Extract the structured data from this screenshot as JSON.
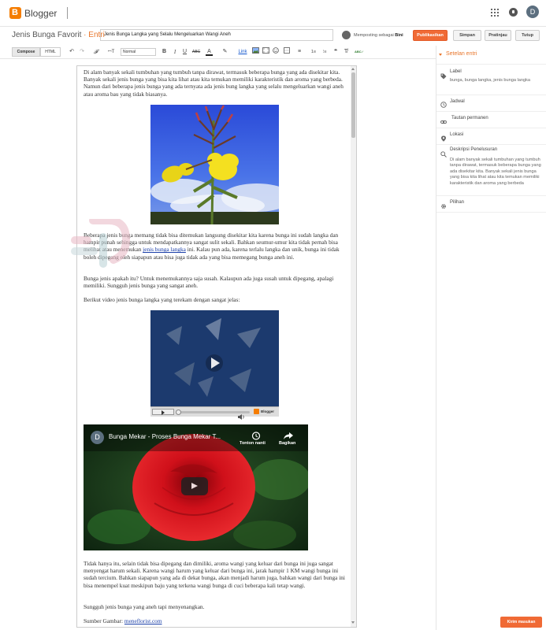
{
  "app": {
    "brand": "Blogger",
    "avatar_letter": "D"
  },
  "post": {
    "blog_title": "Jenis Bunga Favorit",
    "separator": " · ",
    "entry_label": "Entri",
    "title_value": "Jenis Bunga Langka yang Selalu Mengeluarkan Wangi Aneh",
    "posting_as_label": "Memposting sebagai",
    "posting_as_name": "Bini"
  },
  "actions": {
    "publish": "Publikasikan",
    "save": "Simpan",
    "preview": "Pratinjau",
    "close": "Tutup"
  },
  "toolbar": {
    "compose": "Compose",
    "html": "HTML",
    "undo": "↶",
    "redo": "↷",
    "font_family": "𝓕",
    "font_size": "ꟷT",
    "format": "Normal",
    "bold": "B",
    "italic": "I",
    "underline": "U",
    "strike": "ABC",
    "text_color": "A",
    "highlight": "✎",
    "link": "Link",
    "align": "≡",
    "num_list": "1≡",
    "bullet_list": "⁝≡",
    "quote": "❝",
    "clear": "T̸",
    "spell": "ABC✓"
  },
  "content": {
    "p1": "Di alam banyak sekali tumbuhan yang tumbuh tanpa dirawat, termasuk beberapa bunga yang ada disekitar kita. Banyak sekali jenis bunga yang bisa kita lihat atau kita temukan memiliki karakteristik dan aroma yang berbeda.  Namun dari beberapa jenis bunga yang ada ternyata ada jenis bung langka yang selalu mengeluarkan wangi aneh atau aroma bau yang tidak biasanya.",
    "p2_before": "Beberapa jenis bunga memang tidak bisa ditemukan langsung disekitar kita karena bunga ini sudah langka dan hampir punah sehingga untuk mendapatkannya sangat sulit sekali. Bahkan seumur-umur kita tidak pernah bisa melihat atau menemukan ",
    "p2_link": "jenis bunga langka",
    "p2_after": " ini. Kalau pun ada, karena terlalu langka dan unik, bunga ini tidak boleh dipegang oleh siapapun atau bisa juga tidak ada yang bisa memegang bunga aneh ini.",
    "p3": "Bunga jenis apakah itu? Untuk menemukannya saja susah. Kalaupun ada juga susah untuk dipegang, apalagi memiliki. Sungguh jenis bunga yang sangat aneh.",
    "p4": "Berikut video jenis bunga langka yang terekam dengan sangat jelas:",
    "video1_logo": "Blogger",
    "video2_channel": "D",
    "video2_title": "Bunga Mekar - Proses Bunga Mekar T...",
    "video2_watch_later": "Tonton nanti",
    "video2_share": "Bagikan",
    "p5": "Tidak hanya itu, selain tidak bisa dipegang dan dimiliki, aroma wangi yang keluar dari bunga ini juga sangat menyengat harum sekali. Karena wangi harum yang keluar dari bunga ini, jarak hampir 1 KM wangi bunga ini sudah tercium. Bahkan siapapun yang ada di dekat bunga, akan menjadi harum juga, bahkan wangi dari bunga ini bisa menempel kuat meskipun baju yang terkena wangi bunga di cuci beberapa kali tetap wangi.",
    "p6": "Sungguh jenis bunga yang aneh tapi menyenangkan.",
    "source_label": "Sumber Gambar: ",
    "source_link": "meneflorist.com"
  },
  "sidebar": {
    "header": "Setelan entri",
    "label_title": "Label",
    "label_value": "bunga, bunga langka, jenis bunga langka",
    "schedule": "Jadwal",
    "permalink": "Tautan permanen",
    "location": "Lokasi",
    "search_desc_title": "Deskripsi Penelusuran",
    "search_desc_value": "Di alam banyak sekali tumbuhan yang tumbuh tanpa dirawat, termasuk beberapa bunga yang ada disekitar kita. Banyak sekali jenis bunga yang bisa kita lihat atau kita temukan memiliki karakteristik dan aroma yang berbeda",
    "options": "Pilihan"
  },
  "feedback": {
    "send": "Kirim masukan"
  },
  "colors": {
    "accent": "#f06a35",
    "brand": "#f57d00",
    "link": "#1a3ea8"
  }
}
